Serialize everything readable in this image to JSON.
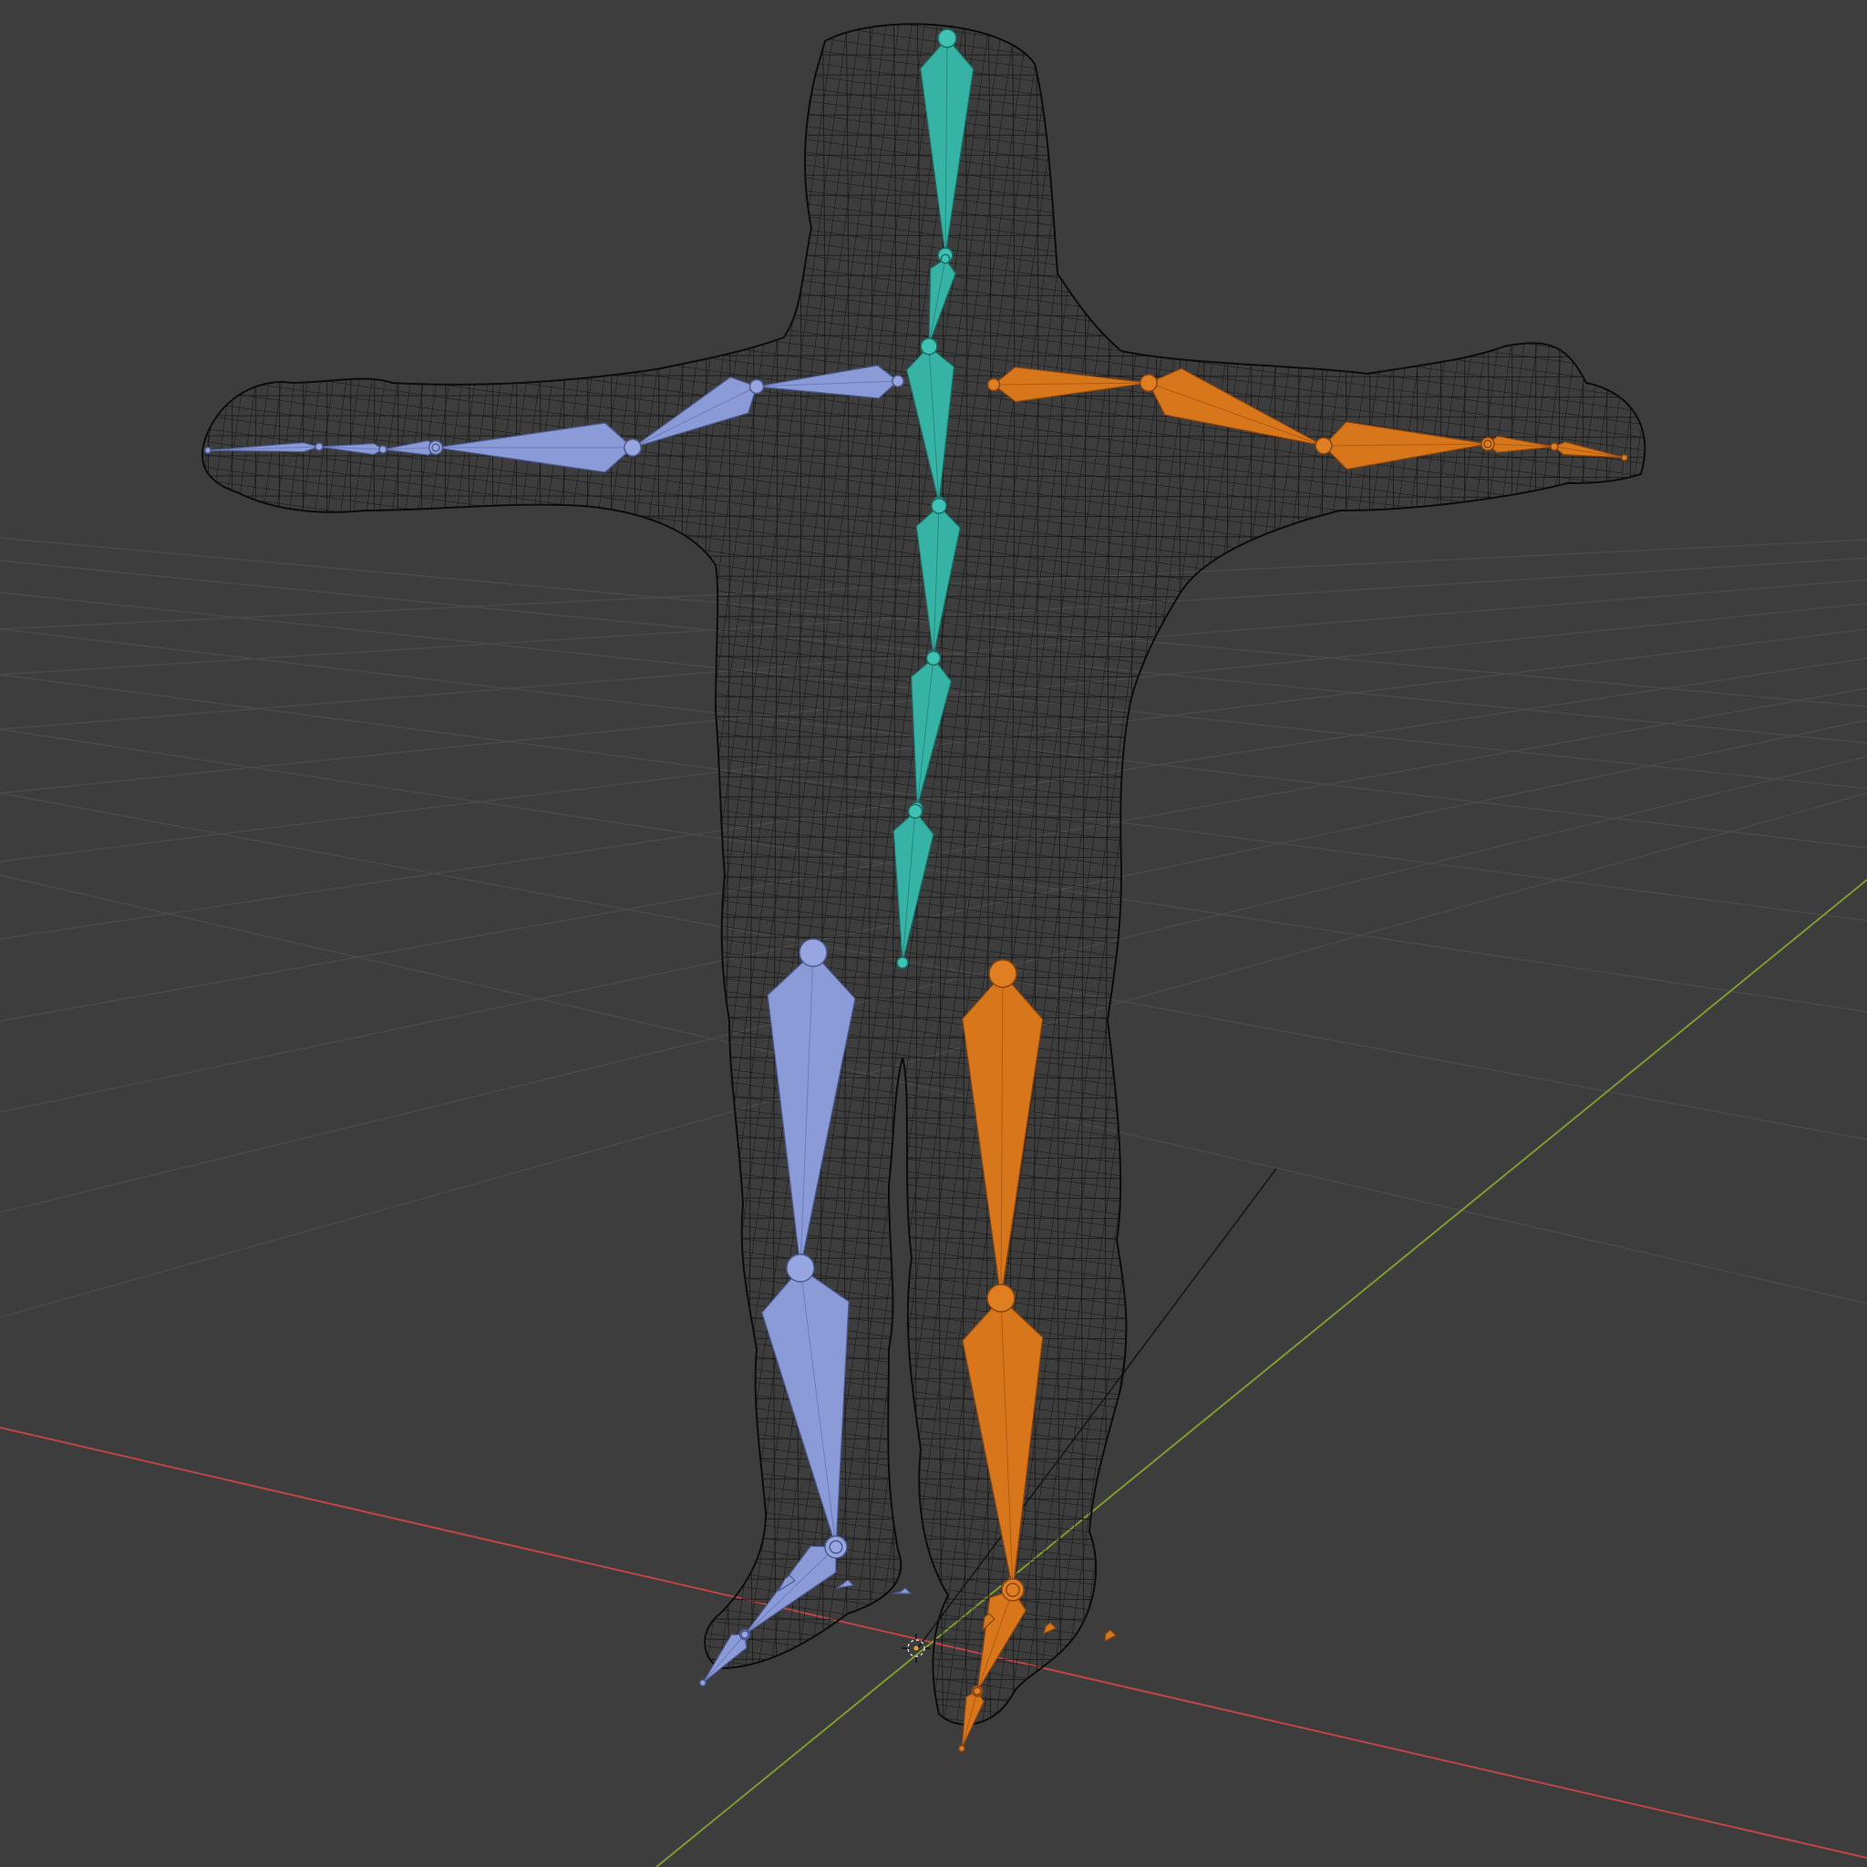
{
  "viewport": {
    "background": "#3d3d3d",
    "grid_color": "#4a4a4a",
    "x_axis_color": "#c04545",
    "y_axis_color": "#7f9a30"
  },
  "object": {
    "mesh_type": "wireframe",
    "wire_color": "#111111"
  },
  "armature": {
    "center_color": "#37b3a6",
    "left_color": "#8a9bd8",
    "right_color": "#d8761b",
    "bone_groups": [
      "spine",
      "left-arm",
      "right-arm",
      "left-leg",
      "right-leg"
    ]
  },
  "icons": {
    "origin": "3d-cursor-icon"
  }
}
